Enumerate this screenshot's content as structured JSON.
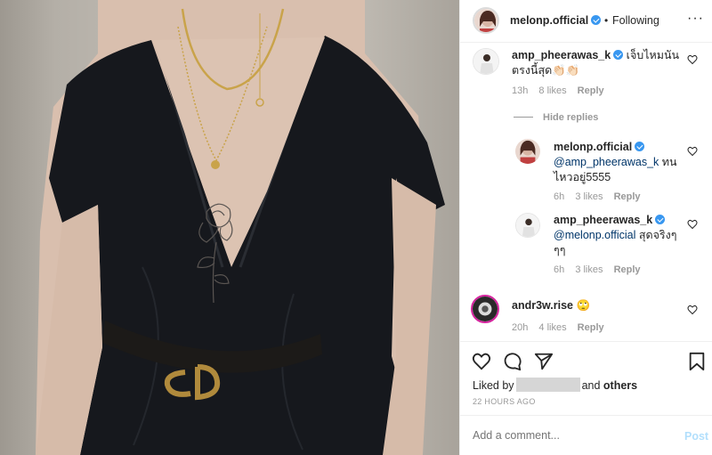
{
  "header": {
    "username": "melonp.official",
    "separator": "•",
    "follow_status": "Following",
    "more": "···"
  },
  "comments": [
    {
      "username": "amp_pheerawas_k",
      "verified": true,
      "text": "เจ็บไหมนัน ตรงนี้สุด👏🏻👏🏻",
      "text_line1": "เจ็บไหมนัน",
      "text_line2": "ตรงนี้สุด👏🏻👏🏻",
      "time": "13h",
      "likes": "8 likes",
      "reply": "Reply"
    }
  ],
  "hide_replies": "Hide replies",
  "replies": [
    {
      "username": "melonp.official",
      "verified": true,
      "mention": "@amp_pheerawas_k",
      "text_after_mention": " ทน",
      "text_line2": "ไหวอยู่5555",
      "time": "6h",
      "likes": "3 likes",
      "reply": "Reply"
    },
    {
      "username": "amp_pheerawas_k",
      "verified": true,
      "mention": "@melonp.official",
      "text_after_mention": " สุดจริงๆ",
      "text_line2": "ๆๆ",
      "time": "6h",
      "likes": "3 likes",
      "reply": "Reply"
    }
  ],
  "comment3": {
    "username": "andr3w.rise",
    "text": "🙄",
    "time": "20h",
    "likes": "4 likes",
    "reply": "Reply"
  },
  "likes_line": {
    "prefix": "Liked by",
    "and": "and",
    "others": "others"
  },
  "timestamp": "22 HOURS AGO",
  "add_comment": {
    "placeholder": "Add a comment...",
    "post": "Post"
  },
  "colors": {
    "verified": "#3897f0",
    "mention": "#003569",
    "post_disabled": "#b2dffc",
    "muted": "#999999"
  },
  "icons": [
    "heart-icon",
    "comment-icon",
    "share-icon",
    "bookmark-icon",
    "verified-badge-icon"
  ]
}
